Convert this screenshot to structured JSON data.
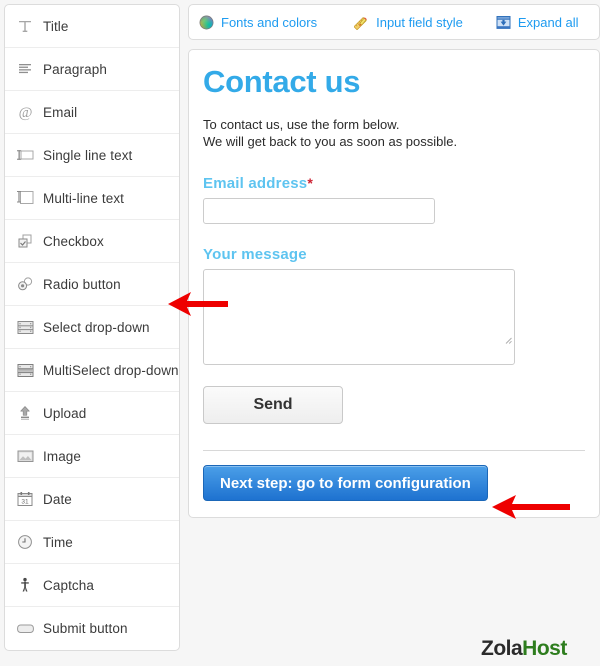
{
  "sidebar": {
    "items": [
      {
        "label": "Title",
        "icon": "title-text-icon"
      },
      {
        "label": "Paragraph",
        "icon": "paragraph-lines-icon"
      },
      {
        "label": "Email",
        "icon": "at-sign-icon"
      },
      {
        "label": "Single line text",
        "icon": "single-line-input-icon"
      },
      {
        "label": "Multi-line text",
        "icon": "multi-line-textarea-icon"
      },
      {
        "label": "Checkbox",
        "icon": "checkbox-icon"
      },
      {
        "label": "Radio button",
        "icon": "radio-button-icon"
      },
      {
        "label": "Select drop-down",
        "icon": "select-dropdown-icon"
      },
      {
        "label": "MultiSelect drop-down",
        "icon": "multiselect-dropdown-icon"
      },
      {
        "label": "Upload",
        "icon": "upload-arrow-icon"
      },
      {
        "label": "Image",
        "icon": "image-picture-icon"
      },
      {
        "label": "Date",
        "icon": "calendar-date-icon"
      },
      {
        "label": "Time",
        "icon": "clock-time-icon"
      },
      {
        "label": "Captcha",
        "icon": "captcha-person-icon"
      },
      {
        "label": "Submit button",
        "icon": "submit-button-icon"
      }
    ]
  },
  "toolbar": {
    "fonts_and_colors": "Fonts and colors",
    "input_field_style": "Input field style",
    "expand_all": "Expand all",
    "icons": {
      "fonts_and_colors": "color-wheel-icon",
      "input_field_style": "ruler-pencil-icon",
      "expand_all": "expand-down-icon"
    }
  },
  "form": {
    "title": "Contact us",
    "description_line1": "To contact us, use the form below.",
    "description_line2": "We will get back to you as soon as possible.",
    "email_label": "Email address",
    "required_marker": "*",
    "email_value": "",
    "email_placeholder": "",
    "message_label": "Your message",
    "message_value": "",
    "message_placeholder": "",
    "send_label": "Send",
    "next_step_label": "Next step: go to form configuration"
  },
  "logo": {
    "part1": "Zola",
    "part2": "Host"
  },
  "colors": {
    "accent_blue": "#33aae8",
    "label_blue": "#5ec4f0",
    "link_blue": "#1e9bf0",
    "button_blue": "#1e72d0",
    "required_red": "#cc2233",
    "arrow_red": "#ee0000",
    "logo_green": "#2e7d1e",
    "page_background": "#f6f6f6"
  }
}
